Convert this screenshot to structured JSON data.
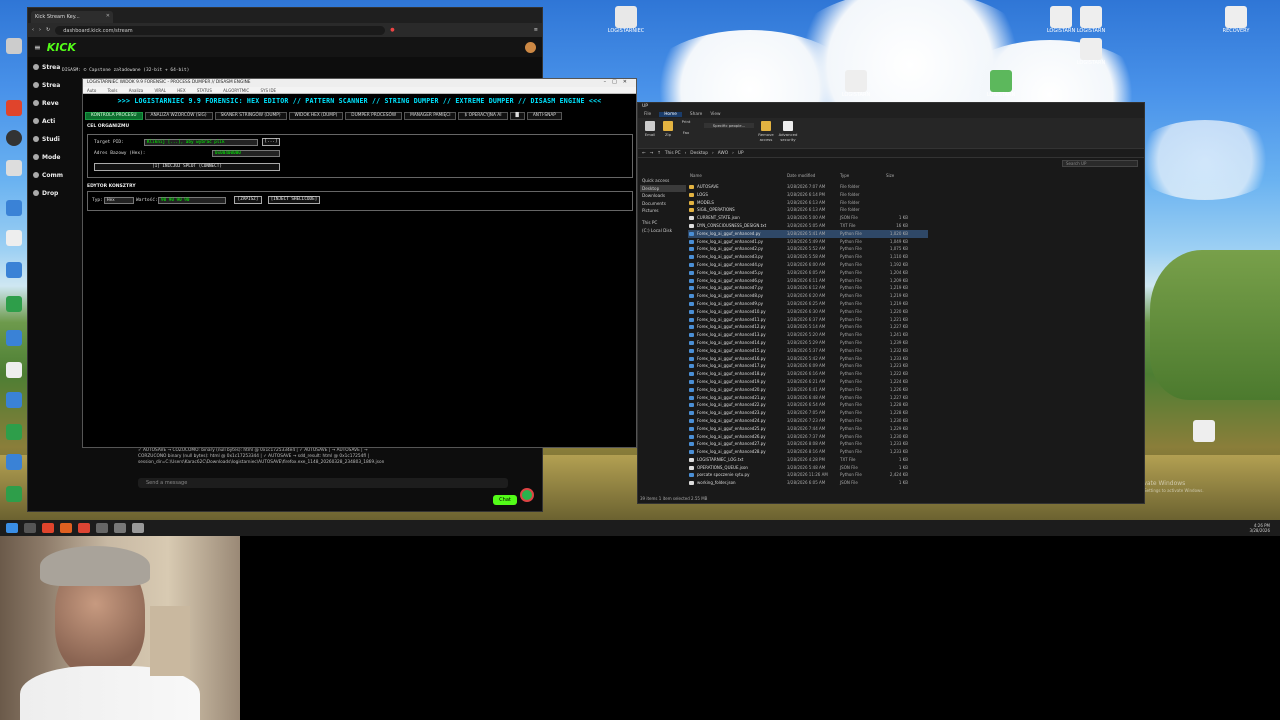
{
  "browser": {
    "tab_title": "Kick Stream Key...",
    "url": "dashboard.kick.com/stream",
    "brand": "KICK",
    "sidebar": [
      "Strea",
      "Strea",
      "Reve",
      "Acti",
      "Studi",
      "Mode",
      "Comm",
      "Drop"
    ],
    "overlay_text": "DISASM: © Capstone załadowane (32-bit + 64-bit)",
    "chat_lines": [
      "✓ AUTOSAVE → COZUCOMO: binary (null bytes): html @ 0x1c1725334e4 | ✓ AUTOSAVE | → AUTOSAVE | →",
      "CORZUCONO binary (null bytes): html @ 0x1c17253344 | ✓ AUTOSAVE → sdd_result: html @ 0x1c17254fl |",
      "session_dir=C:\\Users\\Karac62C\\Downloads\\logistarniec\\AUTOSAVE\\firefox.exe_1148_20260328_234803_1869.json"
    ],
    "chat_placeholder": "Send a message",
    "chat_button": "Chat"
  },
  "tool": {
    "title": "LOGISTARNIEC WIDOK 9.9 FORENSIC - PROCESS DUMPER // DISASM ENGINE",
    "menu": [
      "Auto",
      "Tools",
      "Analiza",
      "VIRAL",
      "HEX",
      "STATUS",
      "ALGORYTMIC",
      "SYS IDE"
    ],
    "banner": ">>> LOGISTARNIEC 9.9 FORENSIC: HEX EDITOR // PATTERN SCANNER // STRING DUMPER // EXTREME DUMPER // DISASM ENGINE <<<",
    "tabs": [
      "KONTROLA PROCESU",
      "ANALIZA WZORCÓW (SIG)",
      "SKANER STRINGÓW (DUMP)",
      "WIDOK HEX (DUMP)",
      "DUMPER PROCESÓW",
      "MANAGER PAMIĘCI",
      "$ OPERACYJNA AI",
      "█",
      "ANTI-SNAP"
    ],
    "section1": "CEL ORGANIZMU",
    "target_label": "Target PID:",
    "target_value": "Kliknij [...], aby wybrać plik",
    "browse_button": "[...]",
    "base_label": "Adres Bazowy (Hex):",
    "base_value": "0x00400000",
    "inject_button": "[1] INICJUJ SPLOT (CONNECT)",
    "section2": "EDYTOR KONSZTRY",
    "type_label": "Typ:",
    "type_value": "Hex",
    "value_label": "Wartość:",
    "value_value": "90 90 90 90",
    "write_button": "[ZAPISZ]",
    "shellcode_button": "[INJECT SHELLCODE]"
  },
  "explorer": {
    "title": "UP",
    "ribbon_tabs": [
      "File",
      "Home",
      "Share",
      "View"
    ],
    "ribbon_buttons": [
      "Email",
      "Zip",
      "Print",
      "Fax",
      "Specific people...",
      "Remove access",
      "Advanced security"
    ],
    "path": [
      "This PC",
      "Desktop",
      "AWO",
      "UP"
    ],
    "search_placeholder": "Search UP",
    "nav": [
      "Quick access",
      "Desktop",
      "Downloads",
      "Documents",
      "Pictures",
      "This PC",
      "(C:) Local Disk"
    ],
    "columns": [
      "Name",
      "Date modified",
      "Type",
      "Size"
    ],
    "files": [
      {
        "n": "AUTOSAVE",
        "d": "3/28/2026 7:07 AM",
        "t": "File folder",
        "s": "",
        "c": "#e3b341"
      },
      {
        "n": "LOGS",
        "d": "3/28/2026 6:14 PM",
        "t": "File folder",
        "s": "",
        "c": "#e3b341"
      },
      {
        "n": "MODELS",
        "d": "3/28/2026 6:13 AM",
        "t": "File folder",
        "s": "",
        "c": "#e3b341"
      },
      {
        "n": "SIGIL_OPERATIONS",
        "d": "3/28/2026 6:13 AM",
        "t": "File folder",
        "s": "",
        "c": "#e3b341"
      },
      {
        "n": "CURRENT_STATE.json",
        "d": "3/28/2026 5:00 AM",
        "t": "JSON File",
        "s": "1 KB",
        "c": "#ddd"
      },
      {
        "n": "DYN_CONSCIOUSNESS_DESIGN.txt",
        "d": "3/28/2026 5:05 AM",
        "t": "TXT File",
        "s": "16 KB",
        "c": "#ddd"
      },
      {
        "n": "Forex_log_ai_gguf_enhanced.py",
        "d": "3/28/2026 5:41 AM",
        "t": "Python File",
        "s": "1,020 KB",
        "c": "#4a8fd6"
      },
      {
        "n": "Forex_log_ai_gguf_enhanced1.py",
        "d": "3/28/2026 5:49 AM",
        "t": "Python File",
        "s": "1,049 KB",
        "c": "#4a8fd6"
      },
      {
        "n": "Forex_log_ai_gguf_enhanced2.py",
        "d": "3/28/2026 5:52 AM",
        "t": "Python File",
        "s": "1,075 KB",
        "c": "#4a8fd6"
      },
      {
        "n": "Forex_log_ai_gguf_enhanced3.py",
        "d": "3/28/2026 5:58 AM",
        "t": "Python File",
        "s": "1,110 KB",
        "c": "#4a8fd6"
      },
      {
        "n": "Forex_log_ai_gguf_enhanced4.py",
        "d": "3/28/2026 6:00 AM",
        "t": "Python File",
        "s": "1,192 KB",
        "c": "#4a8fd6"
      },
      {
        "n": "Forex_log_ai_gguf_enhanced5.py",
        "d": "3/28/2026 6:05 AM",
        "t": "Python File",
        "s": "1,204 KB",
        "c": "#4a8fd6"
      },
      {
        "n": "Forex_log_ai_gguf_enhanced6.py",
        "d": "3/28/2026 6:11 AM",
        "t": "Python File",
        "s": "1,209 KB",
        "c": "#4a8fd6"
      },
      {
        "n": "Forex_log_ai_gguf_enhanced7.py",
        "d": "3/28/2026 6:12 AM",
        "t": "Python File",
        "s": "1,219 KB",
        "c": "#4a8fd6"
      },
      {
        "n": "Forex_log_ai_gguf_enhanced8.py",
        "d": "3/28/2026 6:20 AM",
        "t": "Python File",
        "s": "1,219 KB",
        "c": "#4a8fd6"
      },
      {
        "n": "Forex_log_ai_gguf_enhanced9.py",
        "d": "3/28/2026 6:25 AM",
        "t": "Python File",
        "s": "1,219 KB",
        "c": "#4a8fd6"
      },
      {
        "n": "Forex_log_ai_gguf_enhanced10.py",
        "d": "3/28/2026 6:30 AM",
        "t": "Python File",
        "s": "1,220 KB",
        "c": "#4a8fd6"
      },
      {
        "n": "Forex_log_ai_gguf_enhanced11.py",
        "d": "3/28/2026 6:37 AM",
        "t": "Python File",
        "s": "1,221 KB",
        "c": "#4a8fd6"
      },
      {
        "n": "Forex_log_ai_gguf_enhanced12.py",
        "d": "3/28/2026 5:14 AM",
        "t": "Python File",
        "s": "1,227 KB",
        "c": "#4a8fd6"
      },
      {
        "n": "Forex_log_ai_gguf_enhanced13.py",
        "d": "3/28/2026 5:20 AM",
        "t": "Python File",
        "s": "1,241 KB",
        "c": "#4a8fd6"
      },
      {
        "n": "Forex_log_ai_gguf_enhanced14.py",
        "d": "3/28/2026 5:29 AM",
        "t": "Python File",
        "s": "1,239 KB",
        "c": "#4a8fd6"
      },
      {
        "n": "Forex_log_ai_gguf_enhanced15.py",
        "d": "3/28/2026 5:37 AM",
        "t": "Python File",
        "s": "1,232 KB",
        "c": "#4a8fd6"
      },
      {
        "n": "Forex_log_ai_gguf_enhanced16.py",
        "d": "3/28/2026 5:42 AM",
        "t": "Python File",
        "s": "1,233 KB",
        "c": "#4a8fd6"
      },
      {
        "n": "Forex_log_ai_gguf_enhanced17.py",
        "d": "3/28/2026 6:09 AM",
        "t": "Python File",
        "s": "1,223 KB",
        "c": "#4a8fd6"
      },
      {
        "n": "Forex_log_ai_gguf_enhanced18.py",
        "d": "3/28/2026 6:16 AM",
        "t": "Python File",
        "s": "1,222 KB",
        "c": "#4a8fd6"
      },
      {
        "n": "Forex_log_ai_gguf_enhanced19.py",
        "d": "3/28/2026 6:21 AM",
        "t": "Python File",
        "s": "1,224 KB",
        "c": "#4a8fd6"
      },
      {
        "n": "Forex_log_ai_gguf_enhanced20.py",
        "d": "3/28/2026 6:41 AM",
        "t": "Python File",
        "s": "1,226 KB",
        "c": "#4a8fd6"
      },
      {
        "n": "Forex_log_ai_gguf_enhanced21.py",
        "d": "3/28/2026 6:48 AM",
        "t": "Python File",
        "s": "1,227 KB",
        "c": "#4a8fd6"
      },
      {
        "n": "Forex_log_ai_gguf_enhanced22.py",
        "d": "3/28/2026 6:54 AM",
        "t": "Python File",
        "s": "1,228 KB",
        "c": "#4a8fd6"
      },
      {
        "n": "Forex_log_ai_gguf_enhanced23.py",
        "d": "3/28/2026 7:05 AM",
        "t": "Python File",
        "s": "1,228 KB",
        "c": "#4a8fd6"
      },
      {
        "n": "Forex_log_ai_gguf_enhanced24.py",
        "d": "3/28/2026 7:23 AM",
        "t": "Python File",
        "s": "1,230 KB",
        "c": "#4a8fd6"
      },
      {
        "n": "Forex_log_ai_gguf_enhanced25.py",
        "d": "3/28/2026 7:44 AM",
        "t": "Python File",
        "s": "1,229 KB",
        "c": "#4a8fd6"
      },
      {
        "n": "Forex_log_ai_gguf_enhanced26.py",
        "d": "3/28/2026 7:37 AM",
        "t": "Python File",
        "s": "1,230 KB",
        "c": "#4a8fd6"
      },
      {
        "n": "Forex_log_ai_gguf_enhanced27.py",
        "d": "3/28/2026 8:08 AM",
        "t": "Python File",
        "s": "1,233 KB",
        "c": "#4a8fd6"
      },
      {
        "n": "Forex_log_ai_gguf_enhanced28.py",
        "d": "3/28/2026 8:16 AM",
        "t": "Python File",
        "s": "1,233 KB",
        "c": "#4a8fd6"
      },
      {
        "n": "LOGISTARNIEC_LOG.txt",
        "d": "3/28/2026 4:28 PM",
        "t": "TXT File",
        "s": "1 KB",
        "c": "#ddd"
      },
      {
        "n": "OPERATIONS_QUEUE.json",
        "d": "3/28/2026 5:48 AM",
        "t": "JSON File",
        "s": "1 KB",
        "c": "#ddd"
      },
      {
        "n": "porcate spoczenie sytu.py",
        "d": "3/28/2026 11:26 AM",
        "t": "Python File",
        "s": "2,424 KB",
        "c": "#4a8fd6"
      },
      {
        "n": "working_folder.json",
        "d": "3/28/2026 6:05 AM",
        "t": "JSON File",
        "s": "1 KB",
        "c": "#ddd"
      }
    ],
    "status": "39 items   1 item selected 2.55 MB"
  },
  "desktop": {
    "activate_line1": "Activate Windows",
    "activate_line2": "Go to Settings to activate Windows.",
    "icons": [
      "LOGISTARNIEC",
      "LOGISTARN",
      "LOGISTARN",
      "RECOVERY",
      "LOGISTARN",
      "LOGISTARN",
      "LOGISTARN"
    ]
  },
  "taskbar": {
    "time": "4:26 PM",
    "date": "3/28/2026"
  }
}
